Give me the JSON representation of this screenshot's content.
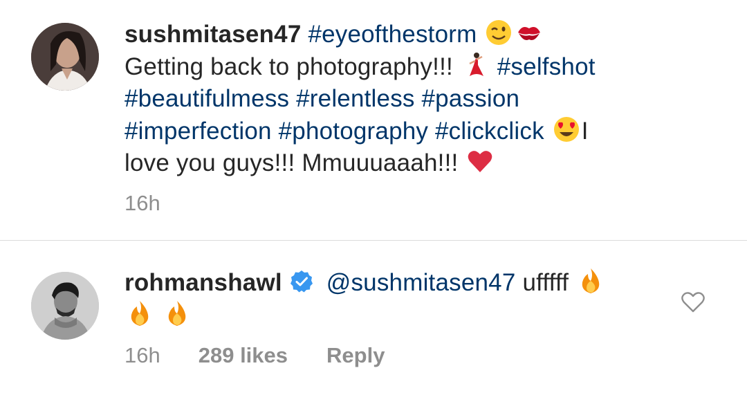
{
  "caption": {
    "username": "sushmitasen47",
    "hashtag_title": "#eyeofthestorm",
    "emoji_1": "winking-face",
    "emoji_2": "kiss-mark",
    "line_text_1": "Getting back to photography!!!",
    "emoji_3": "woman-dancing",
    "hashtags_line": "#selfshot",
    "hashtags_2": "#beautifulmess #relentless #passion",
    "hashtags_3": "#imperfection #photography #clickclick",
    "emoji_4": "heart-eyes",
    "tail_text_1": "I",
    "tail_text_2": "love you guys!!! Mmuuuaaah!!!",
    "emoji_5": "red-heart",
    "time": "16h"
  },
  "reply": {
    "username": "rohmanshawl",
    "verified": "verified-badge-icon",
    "mention": "@sushmitasen47",
    "text": "ufffff",
    "emojis": [
      "fire",
      "fire",
      "fire"
    ],
    "time": "16h",
    "likes": "289 likes",
    "reply_label": "Reply"
  },
  "colors": {
    "text": "#262626",
    "link": "#003569",
    "meta": "#8e8e8e",
    "verified": "#3897f0",
    "divider": "#dbdbdb"
  }
}
